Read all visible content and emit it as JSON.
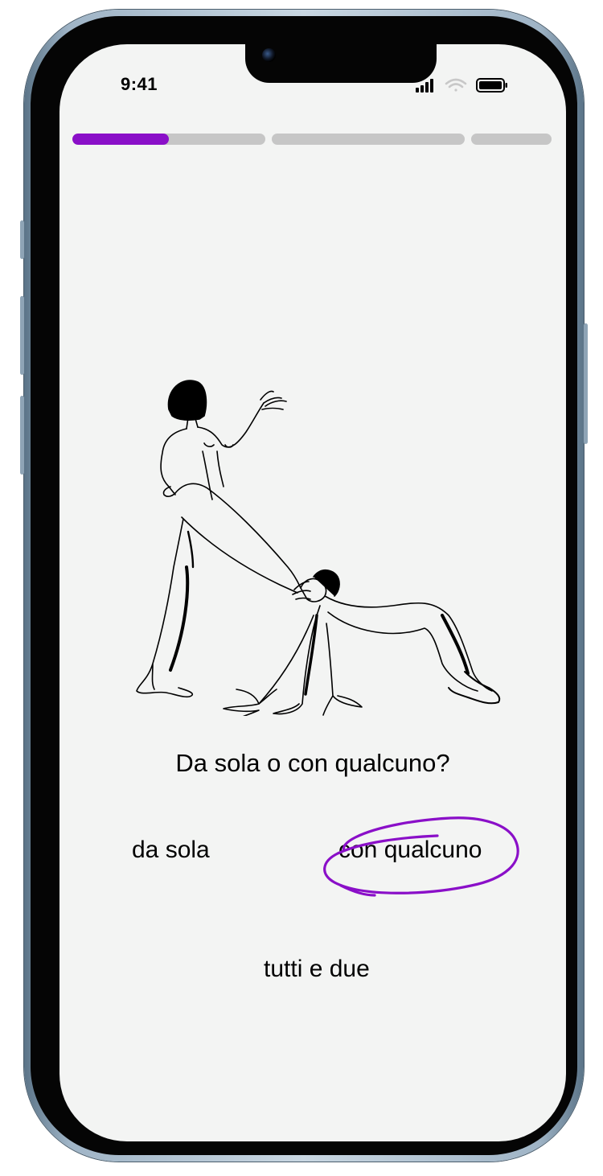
{
  "status_bar": {
    "time": "9:41",
    "icons": [
      "cellular-signal-icon",
      "wifi-icon",
      "battery-icon"
    ]
  },
  "progress": {
    "segments": [
      {
        "fill": 0.5,
        "active": true
      },
      {
        "fill": 0,
        "active": false
      },
      {
        "fill": 0,
        "active": false
      }
    ],
    "active_color": "#8a0fc8",
    "track_color": "#c6c6c6"
  },
  "illustration": {
    "icon": "figures-line-drawing"
  },
  "question": {
    "text": "Da sola o con qualcuno?"
  },
  "options": [
    {
      "label": "da sola",
      "selected": false
    },
    {
      "label": "con qualcuno",
      "selected": true
    },
    {
      "label": "tutti e due",
      "selected": false
    }
  ],
  "colors": {
    "accent": "#8a0fc8",
    "background": "#f3f4f3",
    "text": "#000000"
  }
}
